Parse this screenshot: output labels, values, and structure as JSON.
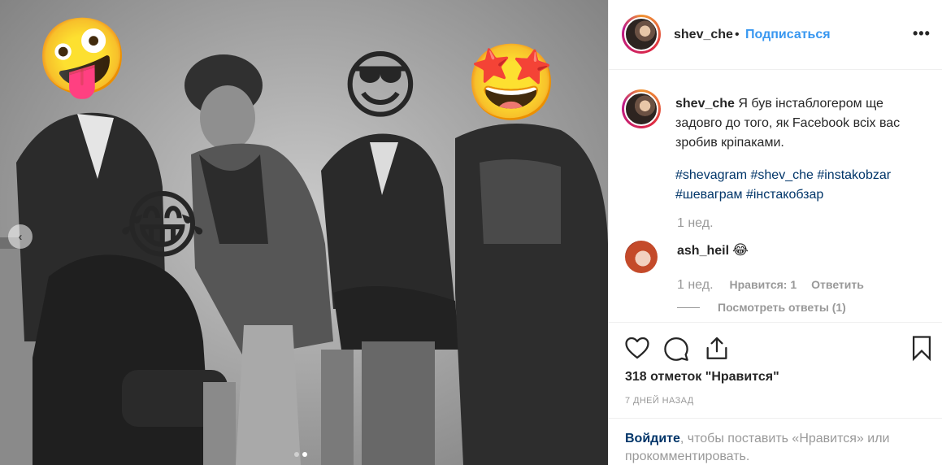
{
  "post": {
    "username": "shev_che",
    "bullet": "•",
    "follow_label": "Подписаться",
    "more_icon": "more-options-icon"
  },
  "photo": {
    "emojis": {
      "wacky": "🤪",
      "cool": "😎",
      "star": "🤩",
      "laugh": "😂"
    },
    "carousel_prev": "‹",
    "carousel_dots": 2,
    "active_dot": 2
  },
  "caption": {
    "username": "shev_che",
    "text": " Я був інстаблогером ще задовго до того, як Facebook всіх вас зробив кріпаками.",
    "hashtags": [
      "#shevagram",
      "#shev_che",
      "#instakobzar",
      "#шеваграм",
      "#інстакобзар"
    ],
    "time": "1 нед."
  },
  "comment": {
    "username": "ash_heil",
    "text": "😂",
    "time": "1 нед.",
    "likes": "Нравится: 1",
    "reply": "Ответить",
    "view_replies": "Посмотреть ответы (1)"
  },
  "actions": {
    "icons": [
      "heart-icon",
      "comment-icon",
      "share-icon",
      "bookmark-icon"
    ],
    "likes": "318 отметок \"Нравится\"",
    "date": "7 ДНЕЙ НАЗАД"
  },
  "login": {
    "link": "Войдите",
    "text": ", чтобы поставить «Нравится» или прокомментировать."
  }
}
